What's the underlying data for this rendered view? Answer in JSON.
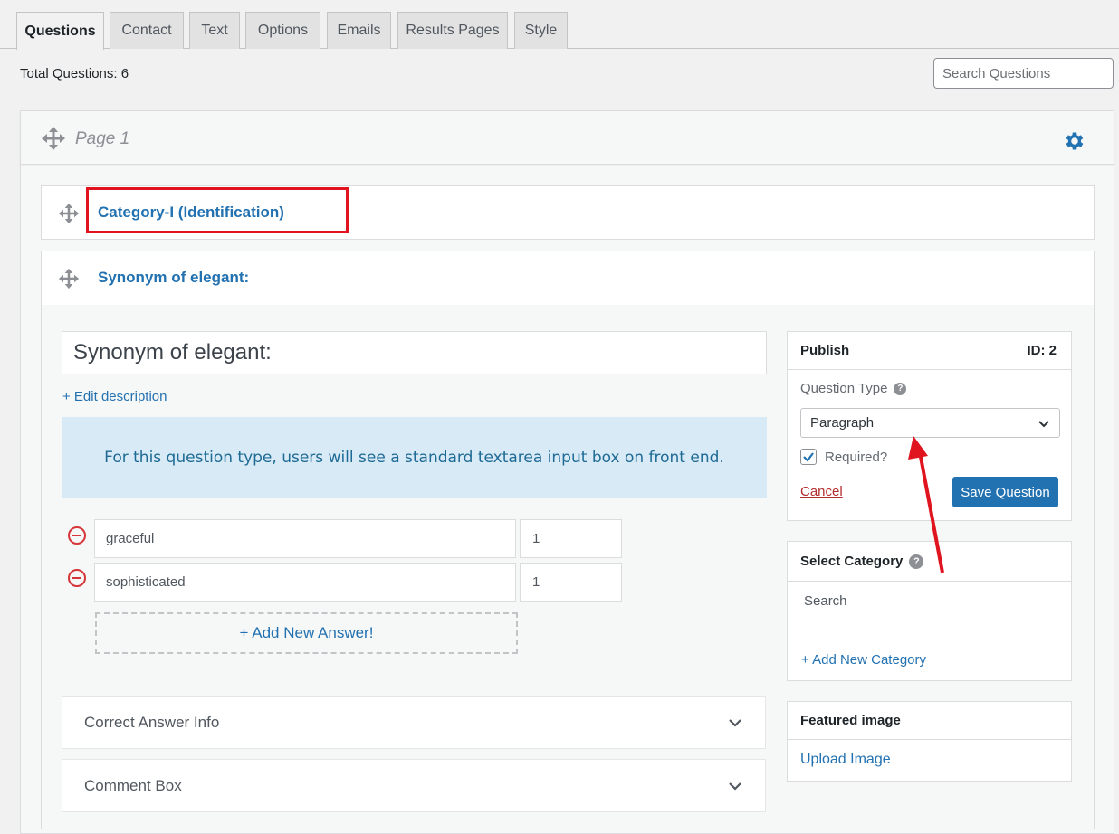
{
  "tabs": [
    {
      "label": "Questions"
    },
    {
      "label": "Contact"
    },
    {
      "label": "Text"
    },
    {
      "label": "Options"
    },
    {
      "label": "Emails"
    },
    {
      "label": "Results Pages"
    },
    {
      "label": "Style"
    }
  ],
  "header": {
    "total_label": "Total Questions:",
    "total_value": "6",
    "search_placeholder": "Search Questions"
  },
  "page": {
    "title": "Page 1"
  },
  "questions": [
    {
      "title": "Category-I (Identification)"
    },
    {
      "title": "Synonym of elegant:"
    }
  ],
  "editor": {
    "question_text": "Synonym of elegant:",
    "edit_description": "+ Edit description",
    "info": "For this question type, users will see a standard textarea input box on front end.",
    "answers": [
      {
        "text": "graceful",
        "points": "1"
      },
      {
        "text": "sophisticated",
        "points": "1"
      }
    ],
    "add_answer": "+ Add New Answer!",
    "accordions": [
      {
        "label": "Correct Answer Info"
      },
      {
        "label": "Comment Box"
      }
    ]
  },
  "publish": {
    "title": "Publish",
    "id_label": "ID: 2",
    "question_type_label": "Question Type",
    "question_type_value": "Paragraph",
    "required_label": "Required?",
    "required_checked": true,
    "cancel": "Cancel",
    "save": "Save Question"
  },
  "category": {
    "title": "Select Category",
    "search_placeholder": "Search",
    "add_new": "+ Add New Category"
  },
  "featured": {
    "title": "Featured image",
    "upload": "Upload Image"
  },
  "colors": {
    "accent": "#2271b1",
    "highlight_box": "#e0141e",
    "annotation_arrow": "#e0141e"
  }
}
